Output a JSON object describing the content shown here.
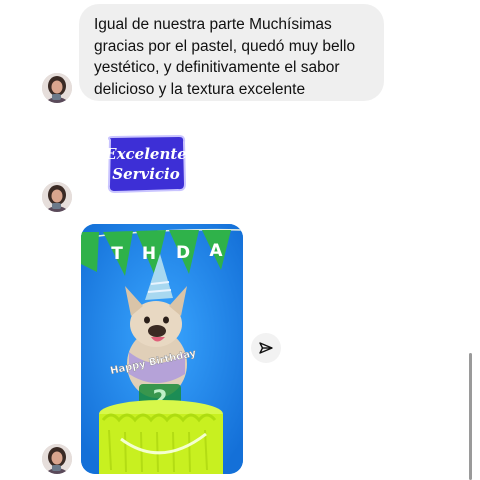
{
  "messages": {
    "text_bubble": {
      "lines": [
        "Igual de nuestra parte Muchísimas",
        "gracias por el pastel,  quedó muy bello",
        "yestético, y definitivamente el sabor",
        "delicioso y la textura excelente"
      ]
    },
    "sticker": {
      "line1": "Excelente",
      "line2": "Servicio",
      "colors": {
        "background": "#3d2fd6",
        "text": "#ffffff",
        "outline": "#c9c4ff"
      }
    },
    "photo": {
      "banner_letters": [
        "T",
        "H",
        "D",
        "A"
      ],
      "topper_text": "Happy Birthday",
      "number": "2",
      "colors": {
        "backdrop": "#1e8cf0",
        "banner": "#2fb24a",
        "cake": "#c8f020",
        "topper": "#1a8c3a"
      }
    }
  },
  "icons": {
    "avatar": "avatar-photo",
    "share": "send-paper-plane-icon"
  }
}
